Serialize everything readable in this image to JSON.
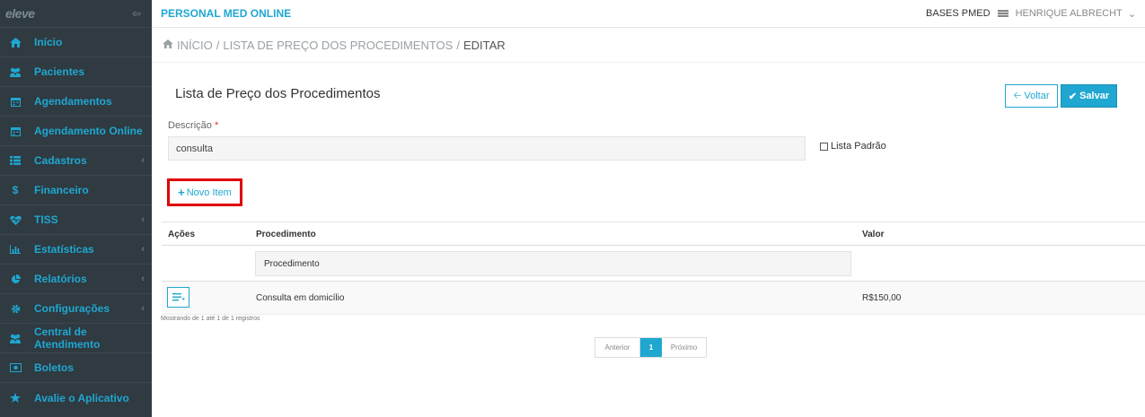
{
  "sidebar": {
    "logo": "eleve",
    "items": [
      {
        "label": "Início",
        "icon": "home-icon",
        "has_sub": false
      },
      {
        "label": "Pacientes",
        "icon": "users-icon",
        "has_sub": false
      },
      {
        "label": "Agendamentos",
        "icon": "calendar-icon",
        "has_sub": false
      },
      {
        "label": "Agendamento Online",
        "icon": "calendar-icon",
        "has_sub": false
      },
      {
        "label": "Cadastros",
        "icon": "list-icon",
        "has_sub": true
      },
      {
        "label": "Financeiro",
        "icon": "dollar-icon",
        "has_sub": false
      },
      {
        "label": "TISS",
        "icon": "heartbeat-icon",
        "has_sub": true
      },
      {
        "label": "Estatísticas",
        "icon": "bar-chart-icon",
        "has_sub": true
      },
      {
        "label": "Relatórios",
        "icon": "pie-chart-icon",
        "has_sub": true
      },
      {
        "label": "Configurações",
        "icon": "gear-icon",
        "has_sub": true
      },
      {
        "label": "Central de Atendimento",
        "icon": "users-icon",
        "has_sub": false
      },
      {
        "label": "Boletos",
        "icon": "barcode-icon",
        "has_sub": false
      },
      {
        "label": "Avalie o Aplicativo",
        "icon": "star-icon",
        "has_sub": false
      }
    ]
  },
  "header": {
    "app_title": "PERSONAL MED ONLINE",
    "bases": "BASES PMED",
    "user": "HENRIQUE ALBRECHT"
  },
  "breadcrumb": {
    "home": "INÍCIO",
    "list": "LISTA DE PREÇO DOS PROCEDIMENTOS",
    "current": "EDITAR"
  },
  "page": {
    "title": "Lista de Preço dos Procedimentos",
    "back_label": "Voltar",
    "save_label": "Salvar"
  },
  "form": {
    "description_label": "Descrição",
    "required_mark": "*",
    "description_value": "consulta",
    "default_list_label": "Lista Padrão",
    "default_list_checked": false,
    "new_item_label": "Novo Item"
  },
  "table": {
    "columns": {
      "actions": "Ações",
      "procedure": "Procedimento",
      "value": "Valor"
    },
    "filter_placeholder": "Procedimento",
    "rows": [
      {
        "procedure": "Consulta em domicílio",
        "value": "R$150,00"
      }
    ],
    "records_info": "Mostrando de 1 até 1 de 1 registros"
  },
  "pagination": {
    "prev": "Anterior",
    "current": "1",
    "next": "Próximo"
  }
}
